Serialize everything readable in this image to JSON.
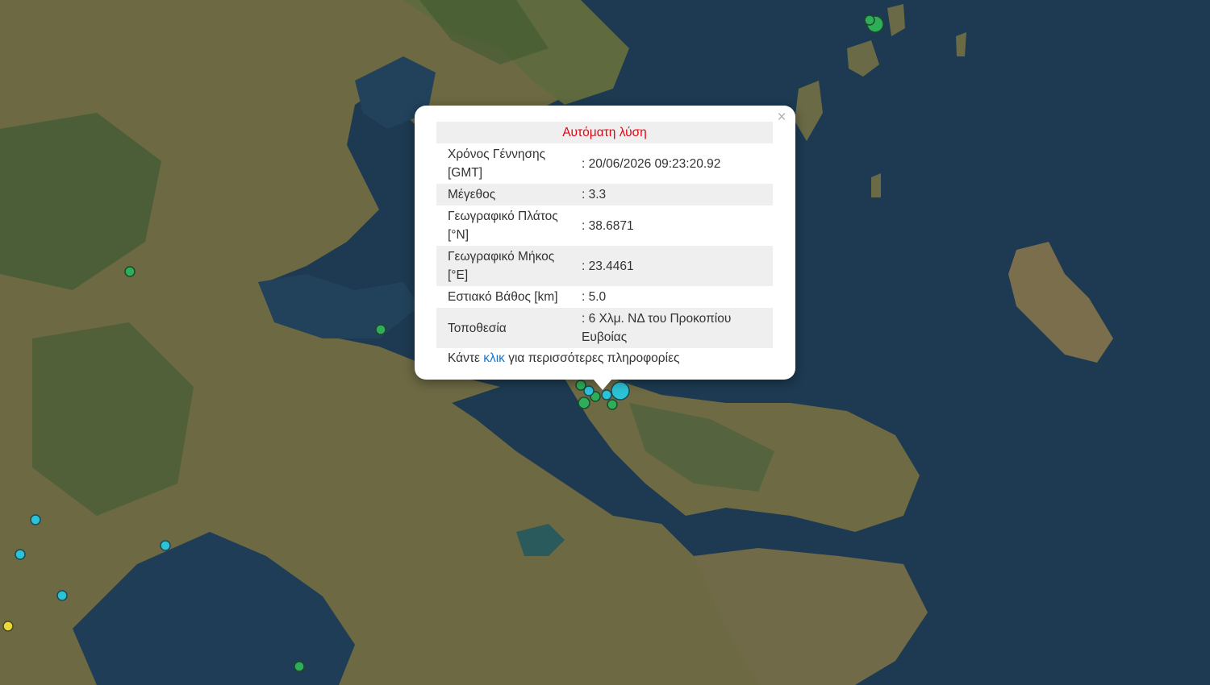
{
  "popup": {
    "title": "Αυτόματη λύση",
    "close_symbol": "×",
    "rows": [
      {
        "label": "Χρόνος Γέννησης [GMT]",
        "value": ": 20/06/2026 09:23:20.92"
      },
      {
        "label": "Μέγεθος",
        "value": ": 3.3"
      },
      {
        "label": "Γεωγραφικό Πλάτος [°N]",
        "value": ": 38.6871"
      },
      {
        "label": "Γεωγραφικό Μήκος [°E]",
        "value": ": 23.4461"
      },
      {
        "label": "Εστιακό Βάθος [km]",
        "value": ": 5.0"
      },
      {
        "label": "Τοποθεσία",
        "value": ": 6 Χλμ. ΝΔ του Προκοπίου Ευβοίας"
      }
    ],
    "more_prefix": "Κάντε",
    "more_link": "κλικ",
    "more_suffix": "για περισσότερες πληροφορίες"
  },
  "colors": {
    "sea": "#1d3a52",
    "land": "#6f6a45",
    "marker_green": "#2fae5a",
    "marker_cyan": "#2cc3d6",
    "marker_yellow": "#e8d83a",
    "title_red": "#e30613",
    "link_blue": "#1a73c9"
  },
  "markers": [
    {
      "color": "green"
    },
    {
      "color": "green"
    },
    {
      "color": "green"
    },
    {
      "color": "green"
    },
    {
      "color": "cyan"
    },
    {
      "color": "cyan"
    },
    {
      "color": "cyan"
    },
    {
      "color": "cyan"
    },
    {
      "color": "yellow"
    },
    {
      "color": "green"
    },
    {
      "color": "cyan"
    },
    {
      "color": "green"
    },
    {
      "color": "cyan"
    },
    {
      "color": "green"
    },
    {
      "color": "green"
    },
    {
      "color": "cyan"
    },
    {
      "color": "green"
    }
  ]
}
